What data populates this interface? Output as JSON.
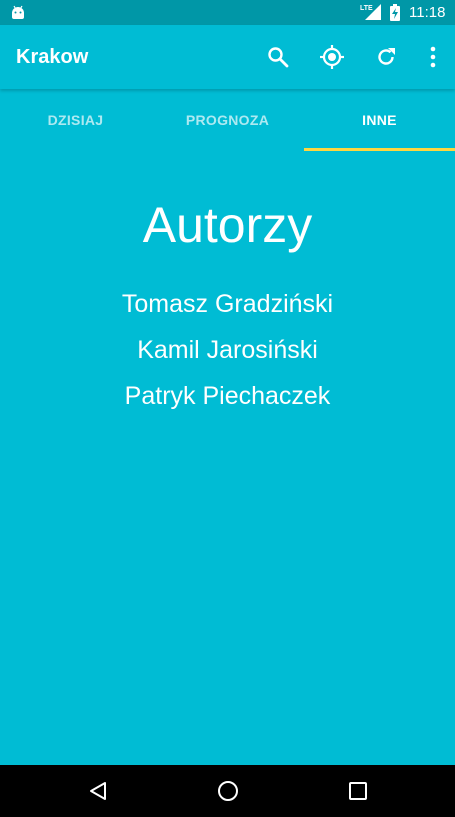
{
  "status_bar": {
    "time": "11:18",
    "network_label": "LTE",
    "icons": [
      "android-icon",
      "lte-signal-icon",
      "battery-charging-icon"
    ]
  },
  "app_bar": {
    "title": "Krakow",
    "actions": [
      "search-icon",
      "location-icon",
      "refresh-icon",
      "more-vert-icon"
    ]
  },
  "tabs": [
    {
      "label": "DZISIAJ",
      "active": false
    },
    {
      "label": "PROGNOZA",
      "active": false
    },
    {
      "label": "INNE",
      "active": true
    }
  ],
  "content": {
    "heading": "Autorzy",
    "authors": [
      "Tomasz Gradziński",
      "Kamil Jarosiński",
      "Patryk Piechaczek"
    ]
  },
  "nav_bar": {
    "buttons": [
      "back-icon",
      "home-icon",
      "recents-icon"
    ]
  },
  "colors": {
    "primary": "#00BCD4",
    "primary_dark": "#0097A7",
    "accent": "#FFD740",
    "nav_bar": "#000000"
  }
}
